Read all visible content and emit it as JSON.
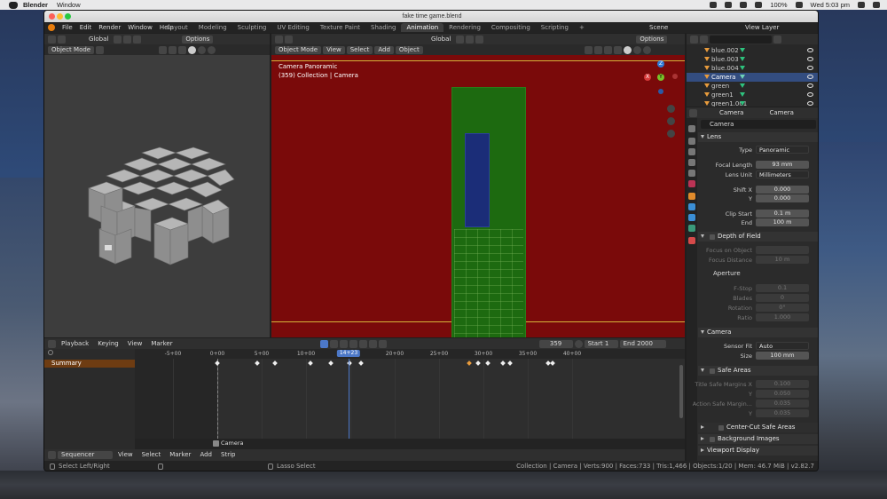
{
  "menubar": {
    "app_name": "Blender",
    "menu": "Window",
    "battery": "100%",
    "clock": "Wed 5:03 pm"
  },
  "window": {
    "title": "fake time game.blend"
  },
  "topbar": {
    "menus": [
      "File",
      "Edit",
      "Render",
      "Window",
      "Help"
    ],
    "workspaces": [
      "Layout",
      "Modeling",
      "Sculpting",
      "UV Editing",
      "Texture Paint",
      "Shading",
      "Animation",
      "Rendering",
      "Compositing",
      "Scripting"
    ],
    "active_workspace": "Animation",
    "add_tab": "+",
    "scene": "Scene",
    "view_layer": "View Layer"
  },
  "left_viewport": {
    "transform": "Global",
    "options": "Options",
    "mode": "Object Mode"
  },
  "camera_viewport": {
    "mode": "Object Mode",
    "menus": [
      "View",
      "Select",
      "Add",
      "Object"
    ],
    "transform": "Global",
    "options": "Options",
    "overlay_title": "Camera Panoramic",
    "overlay_sub": "(359) Collection | Camera",
    "gizmo": {
      "x": "X",
      "y": "Y",
      "z": "Z"
    },
    "colors": {
      "background": "#7a0a0a",
      "green": "#1d6a10",
      "blue": "#1b2d78",
      "horizon": "#d6b33a"
    }
  },
  "timeline": {
    "menus": [
      "Playback",
      "Keying",
      "View",
      "Marker"
    ],
    "current_frame": "359",
    "start_label": "Start",
    "start": "1",
    "end_label": "End",
    "end": "2000",
    "ruler": [
      "-5+00",
      "0+00",
      "5+00",
      "10+00",
      "14+23",
      "20+00",
      "25+00",
      "30+00",
      "35+00",
      "40+00"
    ],
    "playhead": "14+23",
    "summary": "Summary",
    "marker": "Camera"
  },
  "sequencer": {
    "editor": "Sequencer",
    "menus": [
      "View",
      "Select",
      "Marker",
      "Add",
      "Strip"
    ]
  },
  "statusbar": {
    "left": "Select Left/Right",
    "middle": "Lasso Select",
    "right": "Collection | Camera | Verts:900 | Faces:733 | Tris:1,466 | Objects:1/20 | Mem: 46.7 MiB | v2.82.7"
  },
  "outliner": {
    "rows": [
      {
        "name": "blue.002",
        "selected": false
      },
      {
        "name": "blue.003",
        "selected": false
      },
      {
        "name": "blue.004",
        "selected": false
      },
      {
        "name": "Camera",
        "selected": true
      },
      {
        "name": "green",
        "selected": false
      },
      {
        "name": "green1",
        "selected": false
      },
      {
        "name": "green1.001",
        "selected": false
      }
    ]
  },
  "properties": {
    "object_name": "Camera",
    "data_name": "Camera",
    "datablock": "Camera",
    "lens": {
      "title": "Lens",
      "type_label": "Type",
      "type": "Panoramic",
      "focal_label": "Focal Length",
      "focal": "93 mm",
      "unit_label": "Lens Unit",
      "unit": "Millimeters",
      "shiftx_label": "Shift X",
      "shiftx": "0.000",
      "shifty_label": "Y",
      "shifty": "0.000",
      "clipstart_label": "Clip Start",
      "clipstart": "0.1 m",
      "clipend_label": "End",
      "clipend": "100 m"
    },
    "dof": {
      "title": "Depth of Field",
      "focus_obj_label": "Focus on Object",
      "focus_dist_label": "Focus Distance",
      "focus_dist": "10 m",
      "aperture_title": "Aperture",
      "fstop_label": "F-Stop",
      "fstop": "0.1",
      "blades_label": "Blades",
      "blades": "0",
      "rotation_label": "Rotation",
      "rotation": "0°",
      "ratio_label": "Ratio",
      "ratio": "1.000"
    },
    "camera": {
      "title": "Camera",
      "fit_label": "Sensor Fit",
      "fit": "Auto",
      "size_label": "Size",
      "size": "100 mm"
    },
    "safe": {
      "title": "Safe Areas",
      "title_label": "Title Safe Margins X",
      "title_x": "0.100",
      "title_y_label": "Y",
      "title_y": "0.050",
      "action_label": "Action Safe Margin...",
      "action_x": "0.035",
      "action_y_label": "Y",
      "action_y": "0.035",
      "center_cut": "Center-Cut Safe Areas"
    },
    "bg_images": "Background Images",
    "viewport_display": "Viewport Display"
  }
}
